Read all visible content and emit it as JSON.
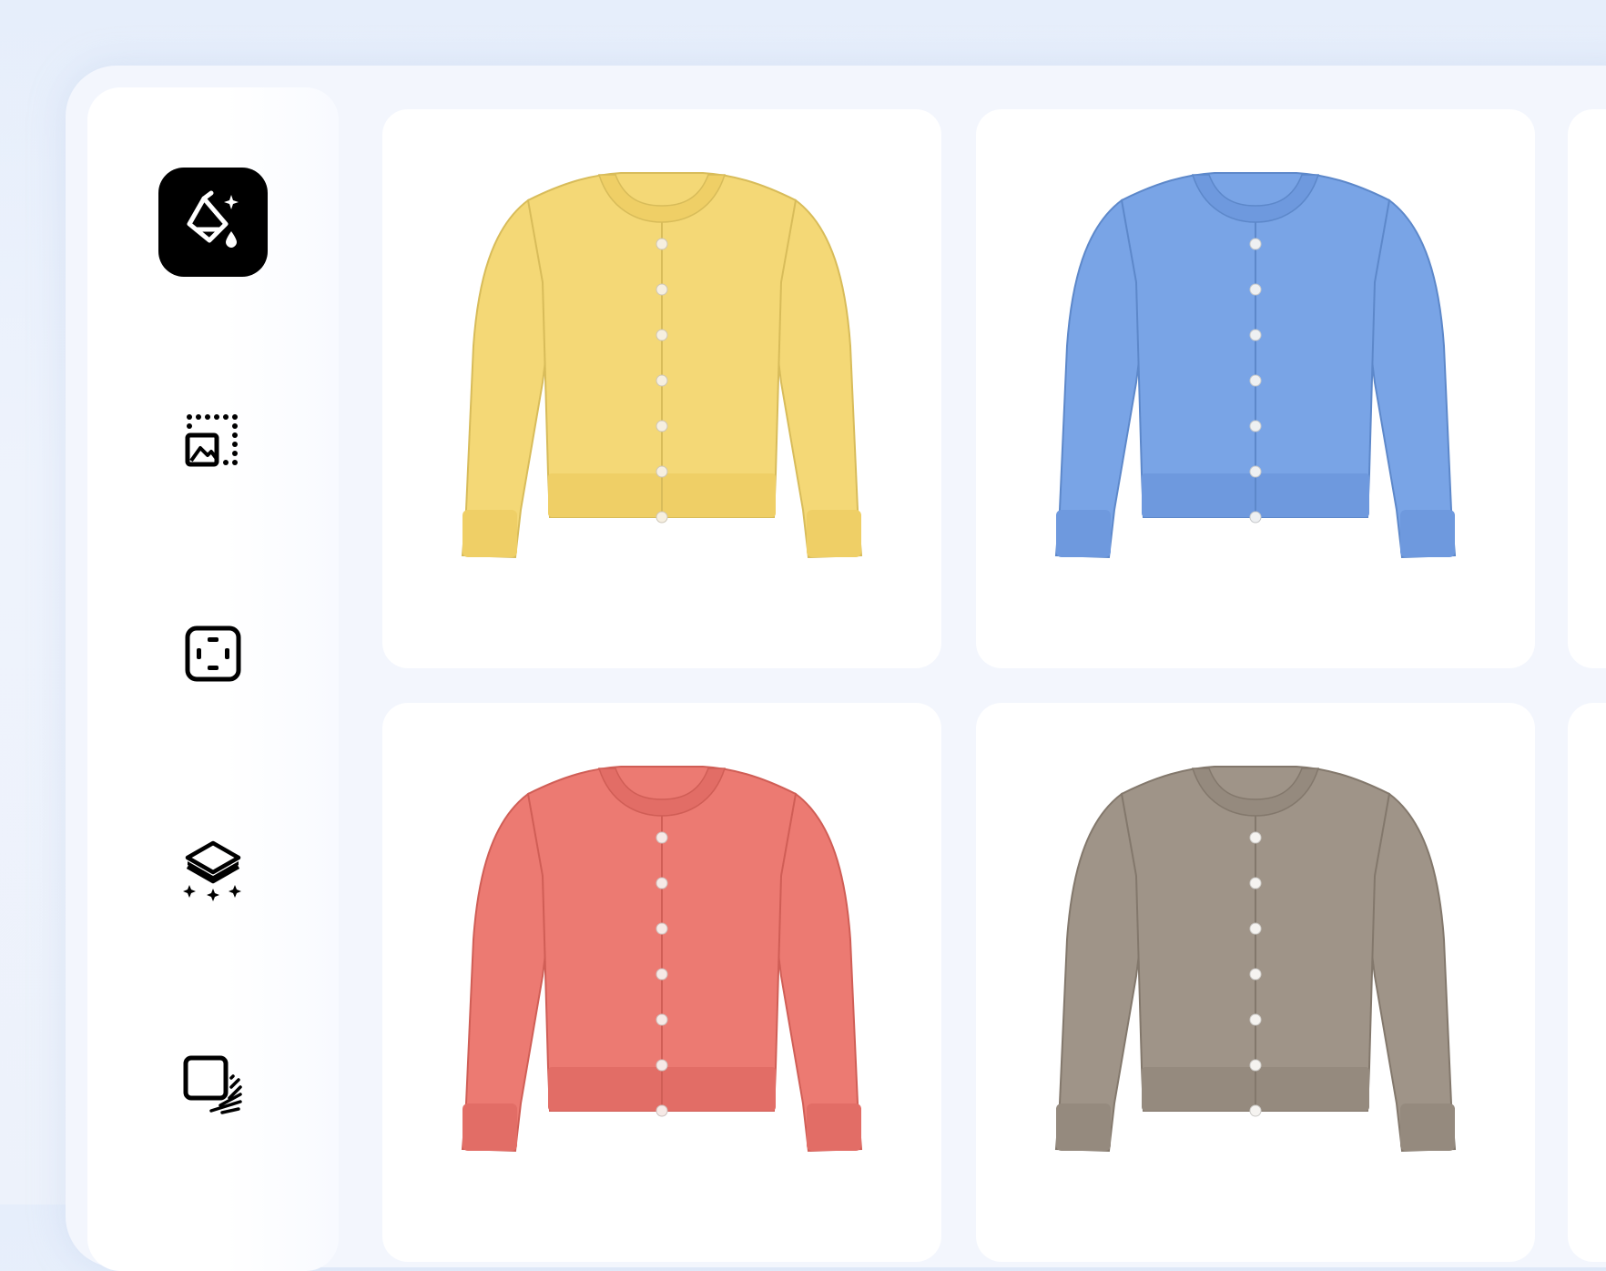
{
  "sidebar": {
    "tools": [
      {
        "icon": "paint-bucket-sparkle-icon",
        "active": true
      },
      {
        "icon": "image-crop-frame-icon",
        "active": false
      },
      {
        "icon": "focus-frame-icon",
        "active": false
      },
      {
        "icon": "layers-sparkle-icon",
        "active": false
      },
      {
        "icon": "square-shadow-icon",
        "active": false
      }
    ]
  },
  "gallery": {
    "items": [
      {
        "color_name": "yellow",
        "color": "#f4d876",
        "rib": "#efcf66",
        "button": "#f6efe0"
      },
      {
        "color_name": "blue",
        "color": "#79a4e6",
        "rib": "#6e99de",
        "button": "#eef0f2"
      },
      {
        "color_name": "coral",
        "color": "#ec7a72",
        "rib": "#e26d66",
        "button": "#f6e9e6"
      },
      {
        "color_name": "taupe",
        "color": "#9f9488",
        "rib": "#958a7e",
        "button": "#f5f3f0"
      }
    ]
  }
}
